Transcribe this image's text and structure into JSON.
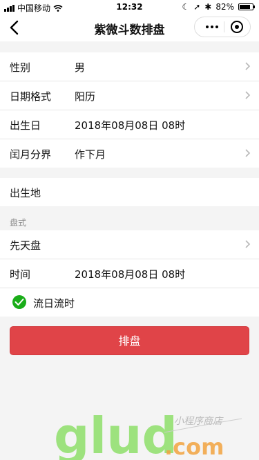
{
  "status": {
    "carrier": "中国移动",
    "time": "12:32",
    "battery": "82%",
    "battery_level": 0.82
  },
  "nav": {
    "title": "紫微斗数排盘"
  },
  "form": {
    "gender": {
      "label": "性别",
      "value": "男"
    },
    "date_format": {
      "label": "日期格式",
      "value": "阳历"
    },
    "birthday": {
      "label": "出生日",
      "value": "2018年08月08日 08时"
    },
    "leap_month": {
      "label": "闰月分界",
      "value": "作下月"
    },
    "birthplace": {
      "label": "出生地"
    }
  },
  "chart_style": {
    "header": "盘式",
    "type": {
      "label": "先天盘",
      "value": ""
    },
    "time": {
      "label": "时间",
      "value": "2018年08月08日 08时"
    },
    "flow_day_hour": {
      "label": "流日流时",
      "checked": true
    }
  },
  "submit_label": "排盘",
  "watermark": {
    "brand": "glud",
    "domain": ".com",
    "tagline": "小程序商店"
  },
  "colors": {
    "accent": "#e04448",
    "check": "#1aad19",
    "watermark": "#8ee06a",
    "watermark_orange": "#f2a340"
  }
}
